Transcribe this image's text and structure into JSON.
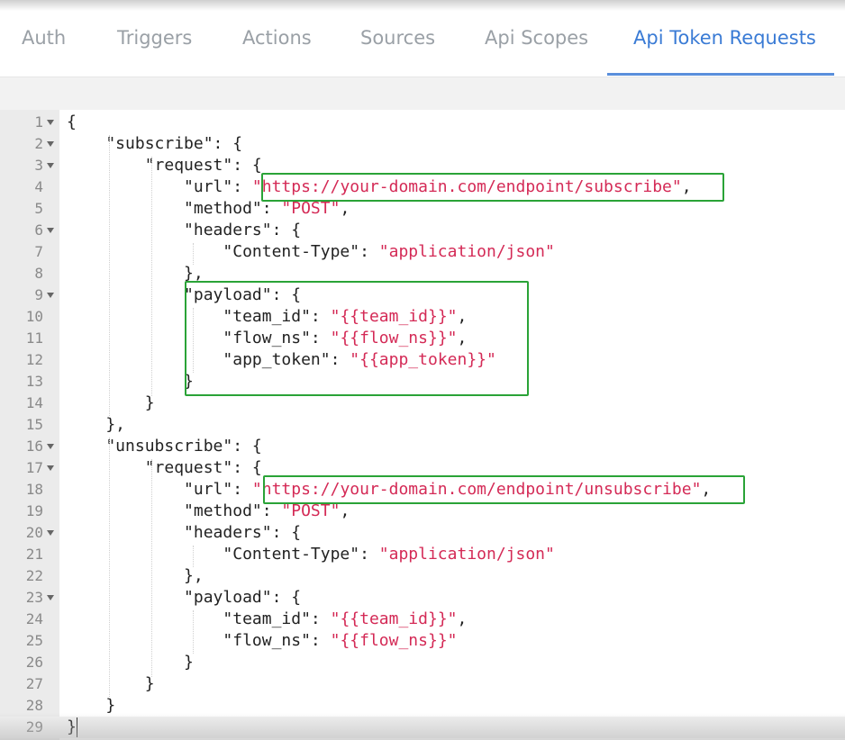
{
  "tabs": [
    {
      "label": "Auth",
      "active": false
    },
    {
      "label": "Triggers",
      "active": false
    },
    {
      "label": "Actions",
      "active": false
    },
    {
      "label": "Sources",
      "active": false
    },
    {
      "label": "Api Scopes",
      "active": false
    },
    {
      "label": "Api Token Requests",
      "active": true
    }
  ],
  "colors": {
    "active_tab": "#3a7bd5",
    "string": "#d42a56",
    "highlight_box": "#2aa337",
    "gutter": "#ebebeb"
  },
  "editor": {
    "language": "json",
    "lines": [
      [
        {
          "t": "{"
        }
      ],
      [
        {
          "t": "    \"subscribe\": {"
        }
      ],
      [
        {
          "t": "        \"request\": {"
        }
      ],
      [
        {
          "t": "            \"url\": "
        },
        {
          "t": "\"https://your-domain.com/endpoint/subscribe\"",
          "s": true
        },
        {
          "t": ","
        }
      ],
      [
        {
          "t": "            \"method\": "
        },
        {
          "t": "\"POST\"",
          "s": true
        },
        {
          "t": ","
        }
      ],
      [
        {
          "t": "            \"headers\": {"
        }
      ],
      [
        {
          "t": "                \"Content-Type\": "
        },
        {
          "t": "\"application/json\"",
          "s": true
        }
      ],
      [
        {
          "t": "            },"
        }
      ],
      [
        {
          "t": "            \"payload\": {"
        }
      ],
      [
        {
          "t": "                \"team_id\": "
        },
        {
          "t": "\"{{team_id}}\"",
          "s": true
        },
        {
          "t": ","
        }
      ],
      [
        {
          "t": "                \"flow_ns\": "
        },
        {
          "t": "\"{{flow_ns}}\"",
          "s": true
        },
        {
          "t": ","
        }
      ],
      [
        {
          "t": "                \"app_token\": "
        },
        {
          "t": "\"{{app_token}}\"",
          "s": true
        }
      ],
      [
        {
          "t": "            }"
        }
      ],
      [
        {
          "t": "        }"
        }
      ],
      [
        {
          "t": "    },"
        }
      ],
      [
        {
          "t": "    \"unsubscribe\": {"
        }
      ],
      [
        {
          "t": "        \"request\": {"
        }
      ],
      [
        {
          "t": "            \"url\": "
        },
        {
          "t": "\"https://your-domain.com/endpoint/unsubscribe\"",
          "s": true
        },
        {
          "t": ","
        }
      ],
      [
        {
          "t": "            \"method\": "
        },
        {
          "t": "\"POST\"",
          "s": true
        },
        {
          "t": ","
        }
      ],
      [
        {
          "t": "            \"headers\": {"
        }
      ],
      [
        {
          "t": "                \"Content-Type\": "
        },
        {
          "t": "\"application/json\"",
          "s": true
        }
      ],
      [
        {
          "t": "            },"
        }
      ],
      [
        {
          "t": "            \"payload\": {"
        }
      ],
      [
        {
          "t": "                \"team_id\": "
        },
        {
          "t": "\"{{team_id}}\"",
          "s": true
        },
        {
          "t": ","
        }
      ],
      [
        {
          "t": "                \"flow_ns\": "
        },
        {
          "t": "\"{{flow_ns}}\"",
          "s": true
        }
      ],
      [
        {
          "t": "            }"
        }
      ],
      [
        {
          "t": "        }"
        }
      ],
      [
        {
          "t": "    }"
        }
      ],
      [
        {
          "t": "}"
        }
      ]
    ],
    "fold_lines": [
      1,
      2,
      3,
      6,
      9,
      16,
      17,
      20,
      23
    ],
    "current_line": 29,
    "highlighted_lines": [
      4,
      9,
      10,
      11,
      12,
      13,
      18
    ]
  }
}
